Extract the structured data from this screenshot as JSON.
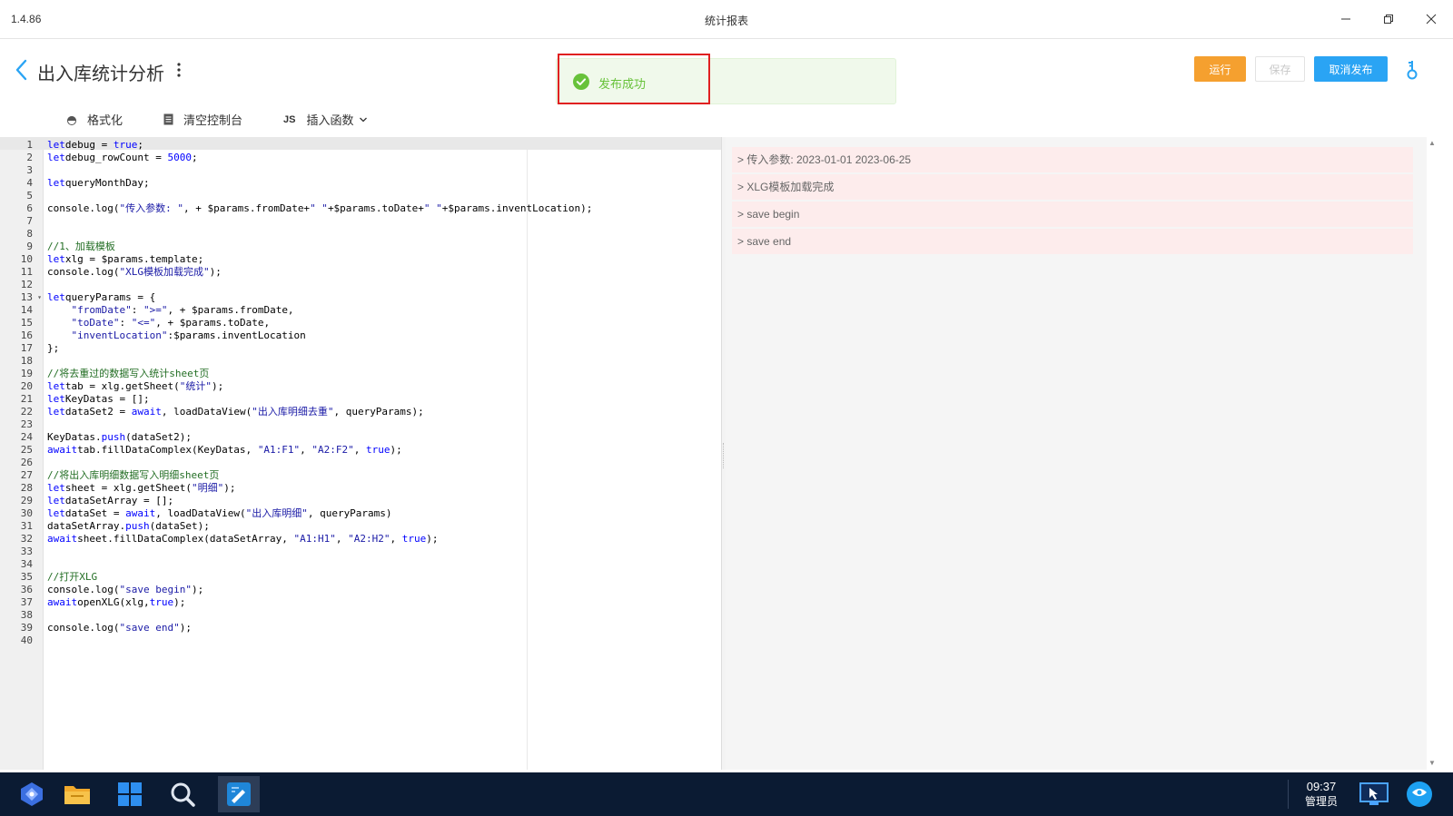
{
  "window": {
    "version": "1.4.86",
    "title": "统计报表"
  },
  "header": {
    "title": "出入库统计分析",
    "run_label": "运行",
    "save_label": "保存",
    "unpublish_label": "取消发布"
  },
  "toast": {
    "message": "发布成功",
    "color": "#67c23a"
  },
  "toolbar": {
    "format_label": "格式化",
    "clear_console_label": "清空控制台",
    "js_badge": "JS",
    "insert_function_label": "插入函数"
  },
  "editor": {
    "lines": [
      {
        "n": "1",
        "segs": [
          [
            "kw",
            "let"
          ],
          [
            "",
            "debug = "
          ],
          [
            "kw",
            "true"
          ],
          [
            "",
            ";"
          ]
        ]
      },
      {
        "n": "2",
        "segs": [
          [
            "kw",
            "let"
          ],
          [
            "",
            "debug_rowCount = "
          ],
          [
            "kw",
            "5000"
          ],
          [
            "",
            ";"
          ]
        ]
      },
      {
        "n": "3",
        "segs": []
      },
      {
        "n": "4",
        "segs": [
          [
            "kw",
            "let"
          ],
          [
            "",
            "queryMonthDay;"
          ]
        ]
      },
      {
        "n": "5",
        "segs": []
      },
      {
        "n": "6",
        "segs": [
          [
            "",
            "console.log("
          ],
          [
            "str",
            "\"传入参数: \""
          ],
          [
            "",
            ", + $params.fromDate+"
          ],
          [
            "str",
            "\" \""
          ],
          [
            "",
            "+$params.toDate+"
          ],
          [
            "str",
            "\" \""
          ],
          [
            "",
            "+$params.inventLocation);"
          ]
        ]
      },
      {
        "n": "7",
        "segs": []
      },
      {
        "n": "8",
        "segs": []
      },
      {
        "n": "9",
        "segs": [
          [
            "cmt",
            "//1、加载模板"
          ]
        ]
      },
      {
        "n": "10",
        "segs": [
          [
            "kw",
            "let"
          ],
          [
            "",
            "xlg = $params.template;"
          ]
        ]
      },
      {
        "n": "11",
        "segs": [
          [
            "",
            "console.log("
          ],
          [
            "str",
            "\"XLG模板加载完成\""
          ],
          [
            "",
            ");"
          ]
        ]
      },
      {
        "n": "12",
        "segs": []
      },
      {
        "n": "13",
        "fold": true,
        "segs": [
          [
            "kw",
            "let"
          ],
          [
            "",
            "queryParams = {"
          ]
        ]
      },
      {
        "n": "14",
        "segs": [
          [
            "",
            "    "
          ],
          [
            "str",
            "\"fromDate\""
          ],
          [
            "",
            ": "
          ],
          [
            "str",
            "\">=\""
          ],
          [
            "",
            ", + $params.fromDate,"
          ]
        ]
      },
      {
        "n": "15",
        "segs": [
          [
            "",
            "    "
          ],
          [
            "str",
            "\"toDate\""
          ],
          [
            "",
            ": "
          ],
          [
            "str",
            "\"<=\""
          ],
          [
            "",
            ", + $params.toDate,"
          ]
        ]
      },
      {
        "n": "16",
        "segs": [
          [
            "",
            "    "
          ],
          [
            "str",
            "\"inventLocation\""
          ],
          [
            "",
            ":$params.inventLocation"
          ]
        ]
      },
      {
        "n": "17",
        "segs": [
          [
            "",
            "};"
          ]
        ]
      },
      {
        "n": "18",
        "segs": []
      },
      {
        "n": "19",
        "segs": [
          [
            "cmt",
            "//将去重过的数据写入统计sheet页"
          ]
        ]
      },
      {
        "n": "20",
        "segs": [
          [
            "kw",
            "let"
          ],
          [
            "",
            "tab = xlg.getSheet("
          ],
          [
            "str",
            "\"统计\""
          ],
          [
            "",
            ");"
          ]
        ]
      },
      {
        "n": "21",
        "segs": [
          [
            "kw",
            "let"
          ],
          [
            "",
            "KeyDatas = [];"
          ]
        ]
      },
      {
        "n": "22",
        "segs": [
          [
            "kw",
            "let"
          ],
          [
            "",
            "dataSet2 = "
          ],
          [
            "kw",
            "await"
          ],
          [
            "",
            ", loadDataView("
          ],
          [
            "str",
            "\"出入库明细去重\""
          ],
          [
            "",
            ", queryParams);"
          ]
        ]
      },
      {
        "n": "23",
        "segs": []
      },
      {
        "n": "24",
        "segs": [
          [
            "",
            "KeyDatas."
          ],
          [
            "kw",
            "push"
          ],
          [
            "",
            "(dataSet2);"
          ]
        ]
      },
      {
        "n": "25",
        "segs": [
          [
            "kw",
            "await"
          ],
          [
            "",
            "tab.fillDataComplex(KeyDatas, "
          ],
          [
            "str",
            "\"A1:F1\""
          ],
          [
            "",
            ", "
          ],
          [
            "str",
            "\"A2:F2\""
          ],
          [
            "",
            ", "
          ],
          [
            "kw",
            "true"
          ],
          [
            "",
            ");"
          ]
        ]
      },
      {
        "n": "26",
        "segs": []
      },
      {
        "n": "27",
        "segs": [
          [
            "cmt",
            "//将出入库明细数据写入明细sheet页"
          ]
        ]
      },
      {
        "n": "28",
        "segs": [
          [
            "kw",
            "let"
          ],
          [
            "",
            "sheet = xlg.getSheet("
          ],
          [
            "str",
            "\"明细\""
          ],
          [
            "",
            ");"
          ]
        ]
      },
      {
        "n": "29",
        "segs": [
          [
            "kw",
            "let"
          ],
          [
            "",
            "dataSetArray = [];"
          ]
        ]
      },
      {
        "n": "30",
        "segs": [
          [
            "kw",
            "let"
          ],
          [
            "",
            "dataSet = "
          ],
          [
            "kw",
            "await"
          ],
          [
            "",
            ", loadDataView("
          ],
          [
            "str",
            "\"出入库明细\""
          ],
          [
            "",
            ", queryParams)"
          ]
        ]
      },
      {
        "n": "31",
        "segs": [
          [
            "",
            "dataSetArray."
          ],
          [
            "kw",
            "push"
          ],
          [
            "",
            "(dataSet);"
          ]
        ]
      },
      {
        "n": "32",
        "segs": [
          [
            "kw",
            "await"
          ],
          [
            "",
            "sheet.fillDataComplex(dataSetArray, "
          ],
          [
            "str",
            "\"A1:H1\""
          ],
          [
            "",
            ", "
          ],
          [
            "str",
            "\"A2:H2\""
          ],
          [
            "",
            ", "
          ],
          [
            "kw",
            "true"
          ],
          [
            "",
            ");"
          ]
        ]
      },
      {
        "n": "33",
        "segs": []
      },
      {
        "n": "34",
        "segs": []
      },
      {
        "n": "35",
        "segs": [
          [
            "cmt",
            "//打开XLG"
          ]
        ]
      },
      {
        "n": "36",
        "segs": [
          [
            "",
            "console.log("
          ],
          [
            "str",
            "\"save begin\""
          ],
          [
            "",
            ");"
          ]
        ]
      },
      {
        "n": "37",
        "segs": [
          [
            "kw",
            "await"
          ],
          [
            "",
            "openXLG(xlg,"
          ],
          [
            "kw",
            "true"
          ],
          [
            "",
            ");"
          ]
        ]
      },
      {
        "n": "38",
        "segs": []
      },
      {
        "n": "39",
        "segs": [
          [
            "",
            "console.log("
          ],
          [
            "str",
            "\"save end\""
          ],
          [
            "",
            ");"
          ]
        ]
      },
      {
        "n": "40",
        "segs": []
      }
    ]
  },
  "console": {
    "logs": [
      "> 传入参数: 2023-01-01 2023-06-25",
      "> XLG模板加载完成",
      "> save begin",
      "> save end"
    ]
  },
  "taskbar": {
    "time": "09:37",
    "user": "管理员",
    "icons": [
      "app-launcher-icon",
      "folder-icon",
      "windows-start-icon",
      "search-icon",
      "report-designer-icon"
    ]
  },
  "colors": {
    "run_button": "#f5a02f",
    "unpublish_button": "#2aa4f4",
    "log_background": "#fdecec",
    "taskbar": "#0b1b33"
  }
}
